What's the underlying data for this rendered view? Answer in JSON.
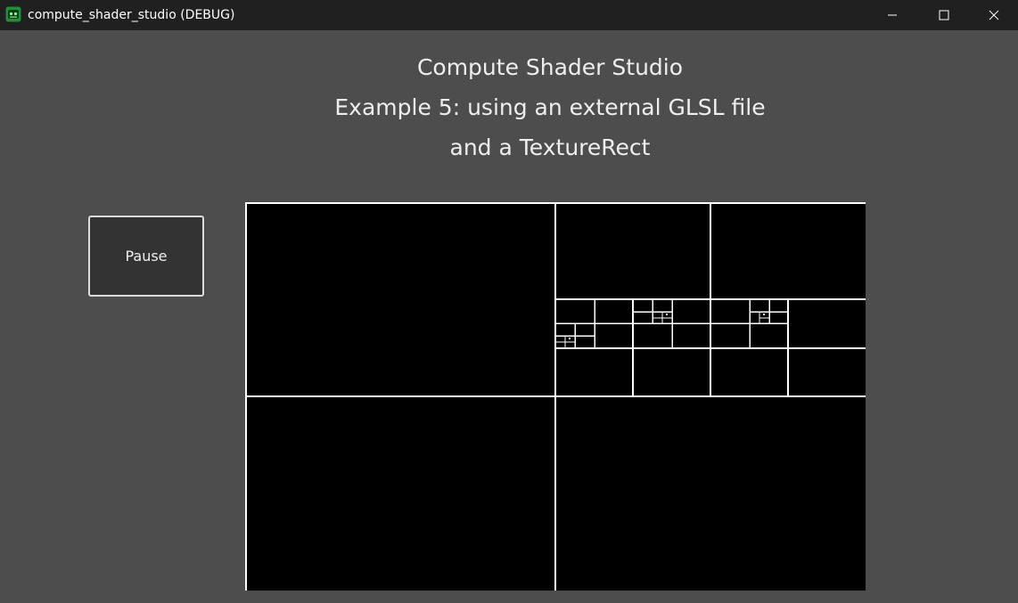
{
  "titlebar": {
    "title": "compute_shader_studio (DEBUG)",
    "app_icon": "godot-icon",
    "controls": {
      "minimize": "minimize-icon",
      "maximize": "maximize-icon",
      "close": "close-icon"
    }
  },
  "main": {
    "heading_lines": [
      "Compute Shader Studio",
      "Example 5: using an external GLSL file",
      "and a TextureRect"
    ],
    "pause_label": "Pause"
  },
  "colors": {
    "titlebar_bg": "#202020",
    "window_bg": "#4d4d4d",
    "button_bg": "#333333",
    "texture_bg": "#000000",
    "texture_lines": "#ffffff"
  }
}
